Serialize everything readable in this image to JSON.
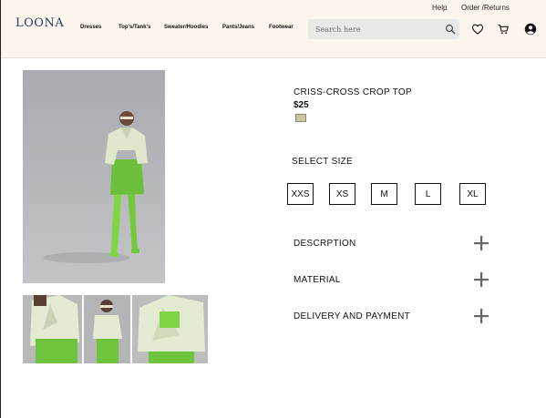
{
  "header": {
    "logo": "LOONA",
    "utility_links": [
      "Help",
      "Order /Returns"
    ],
    "nav": [
      "Dresses",
      "Top's/Tank's",
      "Sweater/Hoodies",
      "Pants/Jeans",
      "Footwear"
    ],
    "search": {
      "placeholder": "Search here",
      "icon": "search-icon"
    },
    "icons": [
      "heart-icon",
      "cart-icon",
      "user-icon"
    ]
  },
  "product": {
    "title": "CRISS-CROSS CROP TOP",
    "price": "$25",
    "swatch_color": "#c9c6a0",
    "size_label": "SELECT SIZE",
    "sizes": [
      "XXS",
      "XS",
      "M",
      "L",
      "XL"
    ]
  },
  "accordion": [
    {
      "label": "DESCRPTION"
    },
    {
      "label": "MATERIAL"
    },
    {
      "label": "DELIVERY AND PAYMENT"
    }
  ],
  "colors": {
    "header_bg": "#fdf6ec",
    "logo": "#2a3a6e",
    "outfit_green": "#7fd644",
    "blazer": "#dfe8cd"
  }
}
